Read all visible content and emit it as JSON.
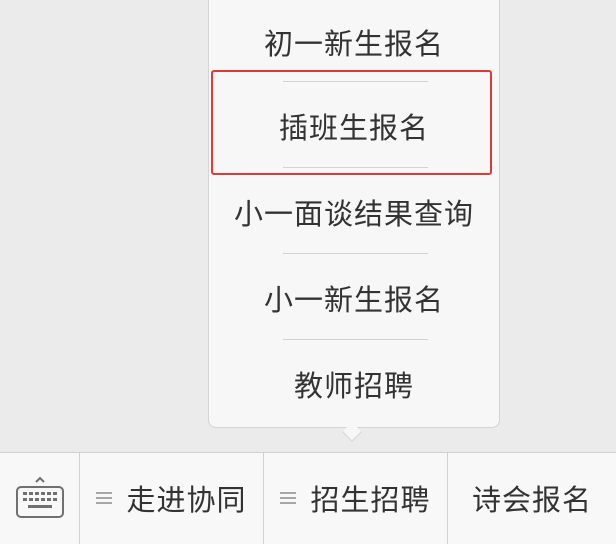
{
  "submenu": {
    "items": [
      {
        "label": "初一新生报名"
      },
      {
        "label": "插班生报名"
      },
      {
        "label": "小一面谈结果查询"
      },
      {
        "label": "小一新生报名"
      },
      {
        "label": "教师招聘"
      }
    ],
    "highlighted_item": "插班生报名",
    "highlight_color": "#dd3a3a"
  },
  "bottom_menu": {
    "keyboard_icon": "keyboard-icon",
    "items": [
      {
        "label": "走进协同",
        "icon": "hamburger-icon"
      },
      {
        "label": "招生招聘",
        "icon": "hamburger-icon"
      },
      {
        "label": "诗会报名"
      }
    ]
  },
  "colors": {
    "background": "#ebebeb",
    "menu_text": "#333333",
    "separator": "#d2d2d2"
  }
}
